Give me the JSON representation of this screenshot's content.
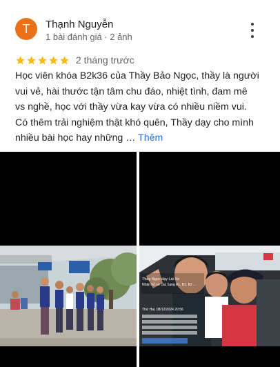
{
  "reviewer": {
    "initial": "T",
    "name": "Thạnh Nguyễn",
    "meta": "1 bài đánh giá · 2 ảnh",
    "avatar_color": "#e8711a"
  },
  "rating": {
    "stars": 5,
    "max": 5,
    "date": "2 tháng trước",
    "star_color": "#fbbc04"
  },
  "review_lines": [
    "Học viên khóa B2k36 của Thầy Bảo Ngọc, thầy là người",
    "vui vẻ, hài thước tận tâm chu đáo, nhiệt tình, đam mê",
    "vs nghề, học với thầy vừa kay vừa có nhiều niềm vui.",
    "Có thêm trải nghiệm thật khó quên, Thầy dạy cho mình",
    "nhiều bài học hay những … "
  ],
  "more_label": "Thêm",
  "photo_overlay": {
    "line1": "Thầy Ngọc dạy Lái Xe",
    "line2": "Nhận hồ sơ các hạng A1, B1, B2 ...",
    "line3": "Thứ Hai, 08/12/2024 20:56"
  },
  "colors": {
    "link": "#1a73e8",
    "text": "#202124",
    "muted": "#5f6368"
  },
  "icons": [
    "more-vert-icon",
    "star-icon"
  ]
}
